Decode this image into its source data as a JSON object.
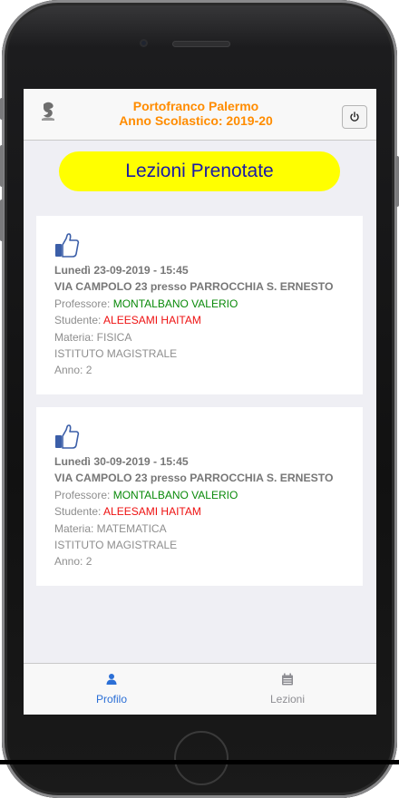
{
  "header": {
    "title_line1": "Portofranco Palermo",
    "title_line2": "Anno Scolastico: 2019-20"
  },
  "banner": {
    "title": "Lezioni Prenotate"
  },
  "lessons": [
    {
      "date": "Lunedì 23-09-2019 - 15:45",
      "location": "VIA CAMPOLO 23 presso PARROCCHIA S. ERNESTO",
      "professor_label": "Professore: ",
      "professor": "MONTALBANO VALERIO",
      "student_label": "Studente: ",
      "student": "ALEESAMI HAITAM",
      "subject": "Materia: FISICA",
      "school": "ISTITUTO MAGISTRALE",
      "year": "Anno: 2"
    },
    {
      "date": "Lunedì 30-09-2019 - 15:45",
      "location": "VIA CAMPOLO 23 presso PARROCCHIA S. ERNESTO",
      "professor_label": "Professore: ",
      "professor": "MONTALBANO VALERIO",
      "student_label": "Studente: ",
      "student": "ALEESAMI HAITAM",
      "subject": "Materia: MATEMATICA",
      "school": "ISTITUTO MAGISTRALE",
      "year": "Anno: 2"
    }
  ],
  "tabs": [
    {
      "label": "Profilo",
      "icon": "person-icon",
      "active": true
    },
    {
      "label": "Lezioni",
      "icon": "calendar-icon",
      "active": false
    }
  ],
  "colors": {
    "header_title": "#ff8c00",
    "banner_bg": "#ffff00",
    "banner_text": "#1a1aa6",
    "professor": "#0a8a0a",
    "student": "#ee1111",
    "tab_active": "#2b6fd6",
    "tab_inactive": "#8e8e93"
  }
}
